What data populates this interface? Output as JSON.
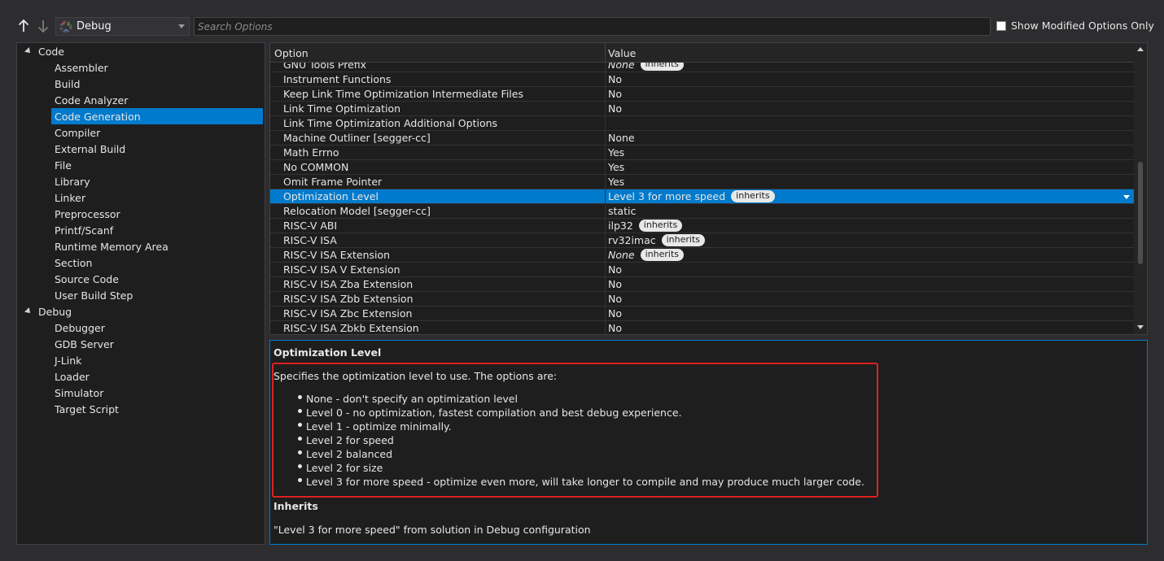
{
  "toolbar": {
    "up_icon": "arrow-up-icon",
    "down_icon": "arrow-down-icon",
    "configuration": "Debug",
    "search_placeholder": "Search Options",
    "show_modified_label": "Show Modified Options Only"
  },
  "tree": {
    "groups": [
      {
        "label": "Code",
        "items": [
          "Assembler",
          "Build",
          "Code Analyzer",
          "Code Generation",
          "Compiler",
          "External Build",
          "File",
          "Library",
          "Linker",
          "Preprocessor",
          "Printf/Scanf",
          "Runtime Memory Area",
          "Section",
          "Source Code",
          "User Build Step"
        ]
      },
      {
        "label": "Debug",
        "items": [
          "Debugger",
          "GDB Server",
          "J-Link",
          "Loader",
          "Simulator",
          "Target Script"
        ]
      }
    ],
    "selected": "Code Generation"
  },
  "grid": {
    "col_option": "Option",
    "col_value": "Value",
    "rows": [
      {
        "name": "GNU Tools Prefix",
        "value": "None",
        "italic": true,
        "inherits": "inherits"
      },
      {
        "name": "Instrument Functions",
        "value": "No"
      },
      {
        "name": "Keep Link Time Optimization Intermediate Files",
        "value": "No"
      },
      {
        "name": "Link Time Optimization",
        "value": "No"
      },
      {
        "name": "Link Time Optimization Additional Options",
        "value": ""
      },
      {
        "name": "Machine Outliner [segger-cc]",
        "value": "None"
      },
      {
        "name": "Math Errno",
        "value": "Yes"
      },
      {
        "name": "No COMMON",
        "value": "Yes"
      },
      {
        "name": "Omit Frame Pointer",
        "value": "Yes"
      },
      {
        "name": "Optimization Level",
        "value": "Level 3 for more speed",
        "inherits": "inherits",
        "selected": true
      },
      {
        "name": "Relocation Model [segger-cc]",
        "value": "static"
      },
      {
        "name": "RISC-V ABI",
        "value": "ilp32",
        "inherits": "inherits"
      },
      {
        "name": "RISC-V ISA",
        "value": "rv32imac",
        "inherits": "inherits"
      },
      {
        "name": "RISC-V ISA Extension",
        "value": "None",
        "italic": true,
        "inherits": "inherits"
      },
      {
        "name": "RISC-V ISA V Extension",
        "value": "No"
      },
      {
        "name": "RISC-V ISA Zba Extension",
        "value": "No"
      },
      {
        "name": "RISC-V ISA Zbb Extension",
        "value": "No"
      },
      {
        "name": "RISC-V ISA Zbc Extension",
        "value": "No"
      },
      {
        "name": "RISC-V ISA Zbkb Extension",
        "value": "No"
      }
    ]
  },
  "description": {
    "title": "Optimization Level",
    "intro": "Specifies the optimization level to use. The options are:",
    "options": [
      "None - don't specify an optimization level",
      "Level 0 - no optimization, fastest compilation and best debug experience.",
      "Level 1 - optimize minimally.",
      "Level 2 for speed",
      "Level 2 balanced",
      "Level 2 for size",
      "Level 3 for more speed - optimize even more, will take longer to compile and may produce much larger code."
    ],
    "inherits_title": "Inherits",
    "inherits_text": "\"Level 3 for more speed\" from solution in Debug configuration"
  },
  "colors": {
    "background": "#2d2d30",
    "panel": "#1e1e1e",
    "accent": "#007acc",
    "highlight": "#e02020"
  }
}
